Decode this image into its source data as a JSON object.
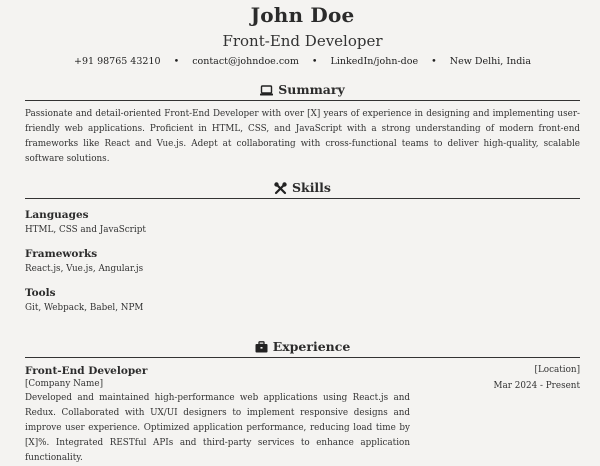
{
  "header": {
    "name": "John Doe",
    "role": "Front-End Developer",
    "phone": "+91 98765 43210",
    "email": "contact@johndoe.com",
    "linkedin": "LinkedIn/john-doe",
    "location": "New Delhi, India",
    "separator": "•"
  },
  "summary": {
    "title": "Summary",
    "icon": "laptop-icon",
    "text": "Passionate and detail-oriented Front-End Developer with over [X] years of experience in designing and implementing user-friendly web applications. Proficient in HTML, CSS, and JavaScript with a strong understanding of modern front-end frameworks like React and Vue.js. Adept at collaborating with cross-functional teams to deliver high-quality, scalable software solutions."
  },
  "skills": {
    "title": "Skills",
    "icon": "tools-icon",
    "groups": [
      {
        "title": "Languages",
        "items": "HTML, CSS and JavaScript"
      },
      {
        "title": "Frameworks",
        "items": "React.js, Vue.js, Angular.js"
      },
      {
        "title": "Tools",
        "items": "Git, Webpack, Babel, NPM"
      }
    ]
  },
  "experience": {
    "title": "Experience",
    "icon": "briefcase-icon",
    "jobs": [
      {
        "title": "Front-End Developer",
        "company": "[Company Name]",
        "location": "[Location]",
        "dates": "Mar 2024 - Present",
        "description": "Developed and maintained high-performance web applications using React.js and Redux. Collaborated with UX/UI designers to implement responsive designs and improve user experience. Optimized application performance, reducing load time by [X]%. Integrated RESTful APIs and third-party services to enhance application functionality."
      }
    ]
  }
}
